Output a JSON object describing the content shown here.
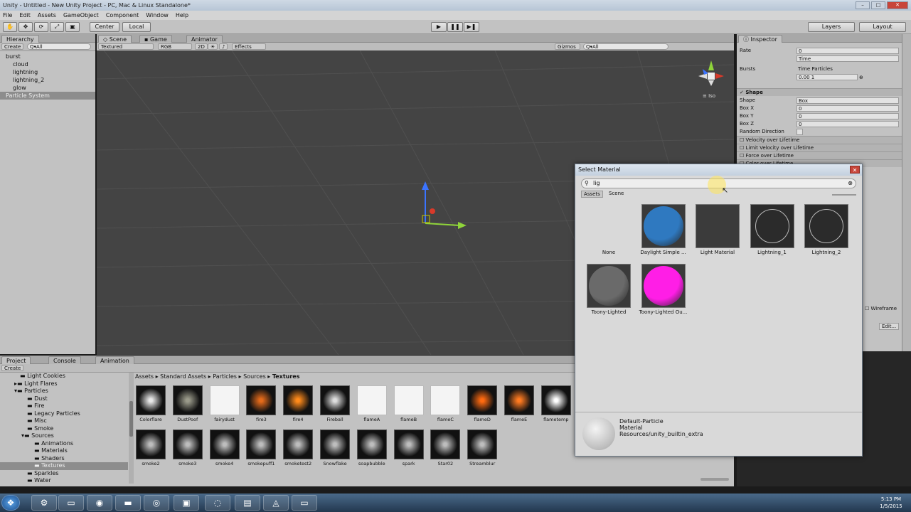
{
  "window": {
    "title": "Unity - Untitled - New Unity Project - PC, Mac & Linux Standalone*",
    "controls": [
      "–",
      "□",
      "✕"
    ]
  },
  "menu": [
    "File",
    "Edit",
    "Assets",
    "GameObject",
    "Component",
    "Window",
    "Help"
  ],
  "toolbar": {
    "pivot": "Center",
    "space": "Local",
    "play": "▶",
    "pause": "❚❚",
    "step": "▶❚",
    "layers": "Layers",
    "layout": "Layout"
  },
  "hierarchy": {
    "tab": "Hierarchy",
    "create": "Create",
    "search_placeholder": "Q▾All",
    "items": [
      {
        "label": "burst",
        "indent": 0,
        "selected": false
      },
      {
        "label": "cloud",
        "indent": 1,
        "selected": false
      },
      {
        "label": "lightning",
        "indent": 1,
        "selected": false
      },
      {
        "label": "lightning_2",
        "indent": 1,
        "selected": false
      },
      {
        "label": "glow",
        "indent": 1,
        "selected": false
      },
      {
        "label": "Particle System",
        "indent": 0,
        "selected": true
      }
    ]
  },
  "scene": {
    "tabs": [
      "Scene",
      "Game",
      "Animator"
    ],
    "shading": "Textured",
    "render": "RGB",
    "mode_2d": "2D",
    "effects": "Effects",
    "gizmos": "Gizmos",
    "search_placeholder": "Q▾All",
    "persp_label": "≡ Iso"
  },
  "inspector": {
    "tab": "Inspector",
    "rows": [
      {
        "label": "Rate",
        "value": "0"
      },
      {
        "label": "",
        "value": "Time"
      },
      {
        "label": "Bursts",
        "value": "Time      Particles"
      },
      {
        "label": "",
        "value": "0.00        1"
      }
    ],
    "shape_header": "Shape",
    "shape_rows": [
      {
        "label": "Shape",
        "value": "Box"
      },
      {
        "label": "Box X",
        "value": "0"
      },
      {
        "label": "Box Y",
        "value": "0"
      },
      {
        "label": "Box Z",
        "value": "0"
      },
      {
        "label": "Random Direction",
        "value": ""
      }
    ],
    "modules": [
      "Velocity over Lifetime",
      "Limit Velocity over Lifetime",
      "Force over Lifetime",
      "Color over Lifetime"
    ],
    "wireframe": "Wireframe",
    "edit": "Edit..."
  },
  "project": {
    "tabs": [
      "Project",
      "Console",
      "Animation"
    ],
    "create": "Create",
    "tree": [
      {
        "label": "Light Cookies",
        "indent": 2
      },
      {
        "label": "Light Flares",
        "indent": 2
      },
      {
        "label": "Particles",
        "indent": 2
      },
      {
        "label": "Dust",
        "indent": 3
      },
      {
        "label": "Fire",
        "indent": 3
      },
      {
        "label": "Legacy Particles",
        "indent": 3
      },
      {
        "label": "Misc",
        "indent": 3
      },
      {
        "label": "Smoke",
        "indent": 3
      },
      {
        "label": "Sources",
        "indent": 3
      },
      {
        "label": "Animations",
        "indent": 4
      },
      {
        "label": "Materials",
        "indent": 4
      },
      {
        "label": "Shaders",
        "indent": 4
      },
      {
        "label": "Textures",
        "indent": 4
      },
      {
        "label": "Sparkles",
        "indent": 3
      },
      {
        "label": "Water",
        "indent": 3
      }
    ],
    "breadcrumb": [
      "Assets",
      "Standard Assets",
      "Particles",
      "Sources",
      "Textures"
    ],
    "assets_row1": [
      "Colorflare",
      "DustPoof",
      "fairydust",
      "fire3",
      "fire4",
      "Fireball",
      "flameA",
      "flameB",
      "flameC",
      "flameD",
      "flameE",
      "flametemp"
    ],
    "assets_row2": [
      "smoke2",
      "smoke3",
      "smoke4",
      "smokepuff1",
      "smoketest2",
      "Snowflake",
      "soapbubble",
      "spark",
      "Star02",
      "Streamblur"
    ]
  },
  "select_material": {
    "title": "Select Material",
    "search_value": "lig",
    "tabs": [
      "Assets",
      "Scene"
    ],
    "items": [
      {
        "label": "None",
        "swatch": "none"
      },
      {
        "label": "Daylight Simple ...",
        "swatch": "#2f79c0"
      },
      {
        "label": "Light Material",
        "swatch": "#3b3b3b"
      },
      {
        "label": "Lightning_1",
        "swatch": "#2b2b2b"
      },
      {
        "label": "Lightning_2",
        "swatch": "#2b2b2b"
      },
      {
        "label": "Toony-Lighted",
        "swatch": "#6a6a6a"
      },
      {
        "label": "Toony-Lighted Ou...",
        "swatch": "#ff1ee6"
      }
    ],
    "preview_name": "Default-Particle",
    "preview_type": "Material",
    "preview_path": "Resources/unity_builtin_extra"
  },
  "taskbar": {
    "time": "5:13 PM",
    "date": "1/5/2015"
  },
  "colors": {
    "scene_bg": "#444444",
    "selection": "#8d8d8d",
    "magenta": "#ff1ee6",
    "blue": "#2f79c0"
  }
}
